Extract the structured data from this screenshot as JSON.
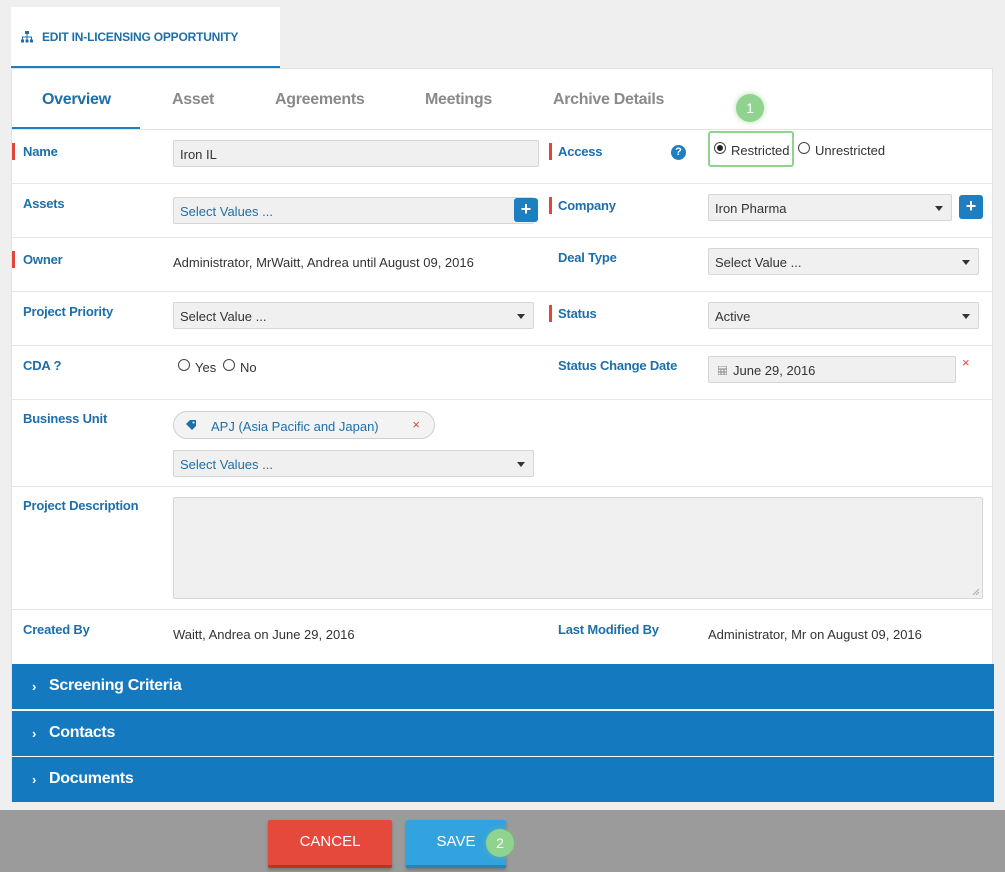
{
  "header": {
    "title": "EDIT IN-LICENSING OPPORTUNITY",
    "icon": "sitemap-icon"
  },
  "tabs": [
    {
      "label": "Overview",
      "active": true
    },
    {
      "label": "Asset",
      "active": false
    },
    {
      "label": "Agreements",
      "active": false
    },
    {
      "label": "Meetings",
      "active": false
    },
    {
      "label": "Archive Details",
      "active": false
    }
  ],
  "form": {
    "name": {
      "label": "Name",
      "value": "Iron IL"
    },
    "access": {
      "label": "Access",
      "help": "?",
      "options": [
        "Restricted",
        "Unrestricted"
      ],
      "selected": "Restricted"
    },
    "assets": {
      "label": "Assets",
      "placeholder": "Select Values ...",
      "add": "+"
    },
    "company": {
      "label": "Company",
      "value": "Iron Pharma",
      "add": "+"
    },
    "owner": {
      "label": "Owner",
      "value": "Administrator, MrWaitt, Andrea until August 09, 2016"
    },
    "deal_type": {
      "label": "Deal Type",
      "value": "Select Value ..."
    },
    "project_priority": {
      "label": "Project Priority",
      "value": "Select Value ..."
    },
    "status": {
      "label": "Status",
      "value": "Active"
    },
    "cda": {
      "label": "CDA ?",
      "options": [
        "Yes",
        "No"
      ]
    },
    "status_change_date": {
      "label": "Status Change Date",
      "value": "June 29, 2016",
      "clear": "×"
    },
    "business_unit": {
      "label": "Business Unit",
      "chip": "APJ (Asia Pacific and Japan)",
      "chip_remove": "×",
      "placeholder": "Select Values ..."
    },
    "project_description": {
      "label": "Project Description",
      "value": ""
    },
    "created_by": {
      "label": "Created By",
      "value": "Waitt, Andrea on June 29, 2016"
    },
    "last_modified_by": {
      "label": "Last Modified By",
      "value": "Administrator, Mr on August 09, 2016"
    }
  },
  "sections": [
    {
      "chevron": "›",
      "label": "Screening Criteria"
    },
    {
      "chevron": "›",
      "label": "Contacts"
    },
    {
      "chevron": "›",
      "label": "Documents"
    }
  ],
  "footer": {
    "cancel": "CANCEL",
    "save": "SAVE"
  },
  "callouts": [
    "1",
    "2"
  ],
  "colors": {
    "brand": "#1479be",
    "link": "#1d6fa9",
    "required": "#e0463a",
    "cancel": "#e5493b",
    "save": "#33a3df",
    "callout": "#8fd38f"
  }
}
